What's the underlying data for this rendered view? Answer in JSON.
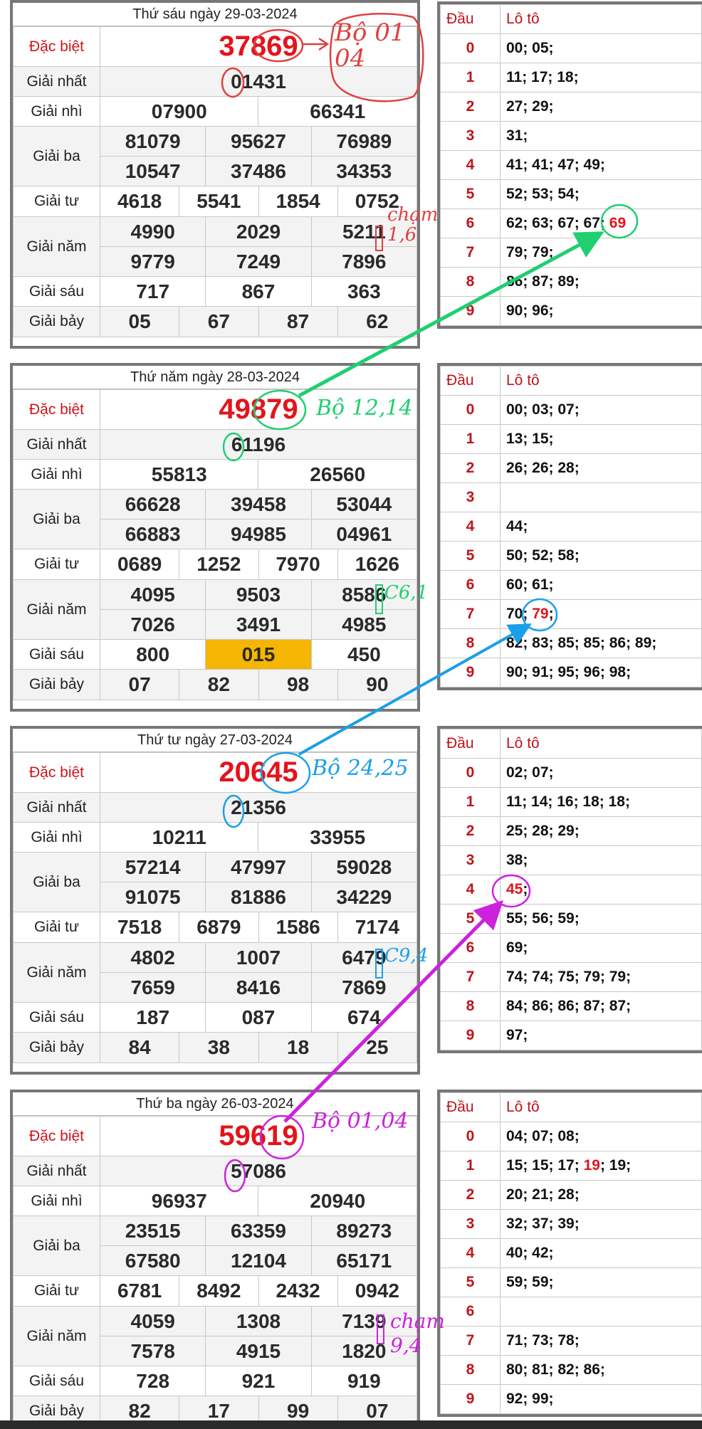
{
  "labels": {
    "special": "Đặc biệt",
    "first": "Giải nhất",
    "second": "Giải nhì",
    "third": "Giải ba",
    "fourth": "Giải tư",
    "fifth": "Giải năm",
    "sixth": "Giải sáu",
    "seventh": "Giải bảy",
    "dau": "Đầu",
    "loto": "Lô tô"
  },
  "days": [
    {
      "date": "Thứ sáu ngày 29-03-2024",
      "special": "37869",
      "first": "01431",
      "second": [
        "07900",
        "66341"
      ],
      "third": [
        "81079",
        "95627",
        "76989",
        "10547",
        "37486",
        "34353"
      ],
      "fourth": [
        "4618",
        "5541",
        "1854",
        "0752"
      ],
      "fifth": [
        "4990",
        "2029",
        "5211",
        "9779",
        "7249",
        "7896"
      ],
      "sixth": [
        "717",
        "867",
        "363"
      ],
      "seventh": [
        "05",
        "67",
        "87",
        "62"
      ],
      "loto": [
        {
          "head": "0",
          "values": "00; 05;"
        },
        {
          "head": "1",
          "values": "11; 17; 18;"
        },
        {
          "head": "2",
          "values": "27; 29;"
        },
        {
          "head": "3",
          "values": "31;"
        },
        {
          "head": "4",
          "values": "41; 41; 47; 49;"
        },
        {
          "head": "5",
          "values": "52; 53; 54;"
        },
        {
          "head": "6",
          "values": "62; 63; 67; 67;",
          "red": "69"
        },
        {
          "head": "7",
          "values": "79; 79;"
        },
        {
          "head": "8",
          "values": "86; 87; 89;"
        },
        {
          "head": "9",
          "values": "90; 96;"
        }
      ]
    },
    {
      "date": "Thứ năm ngày 28-03-2024",
      "special": "49879",
      "first": "61196",
      "second": [
        "55813",
        "26560"
      ],
      "third": [
        "66628",
        "39458",
        "53044",
        "66883",
        "94985",
        "04961"
      ],
      "fourth": [
        "0689",
        "1252",
        "7970",
        "1626"
      ],
      "fifth": [
        "4095",
        "9503",
        "8586",
        "7026",
        "3491",
        "4985"
      ],
      "sixth": [
        "800",
        "015",
        "450"
      ],
      "seventh": [
        "07",
        "82",
        "98",
        "90"
      ],
      "loto": [
        {
          "head": "0",
          "values": "00; 03; 07;"
        },
        {
          "head": "1",
          "values": "13; 15;"
        },
        {
          "head": "2",
          "values": "26; 26; 28;"
        },
        {
          "head": "3",
          "values": ""
        },
        {
          "head": "4",
          "values": "44;"
        },
        {
          "head": "5",
          "values": "50; 52; 58;"
        },
        {
          "head": "6",
          "values": "60; 61;"
        },
        {
          "head": "7",
          "values": "70;",
          "red": "79",
          "after": ";"
        },
        {
          "head": "8",
          "values": "82; 83; 85; 85; 86; 89;"
        },
        {
          "head": "9",
          "values": "90; 91; 95; 96; 98;"
        }
      ]
    },
    {
      "date": "Thứ tư ngày 27-03-2024",
      "special": "20645",
      "first": "21356",
      "second": [
        "10211",
        "33955"
      ],
      "third": [
        "57214",
        "47997",
        "59028",
        "91075",
        "81886",
        "34229"
      ],
      "fourth": [
        "7518",
        "6879",
        "1586",
        "7174"
      ],
      "fifth": [
        "4802",
        "1007",
        "6479",
        "7659",
        "8416",
        "7869"
      ],
      "sixth": [
        "187",
        "087",
        "674"
      ],
      "seventh": [
        "84",
        "38",
        "18",
        "25"
      ],
      "loto": [
        {
          "head": "0",
          "values": "02; 07;"
        },
        {
          "head": "1",
          "values": "11; 14; 16; 18; 18;"
        },
        {
          "head": "2",
          "values": "25; 28; 29;"
        },
        {
          "head": "3",
          "values": "38;"
        },
        {
          "head": "4",
          "values": "",
          "red": "45",
          "after": ";"
        },
        {
          "head": "5",
          "values": "55; 56; 59;"
        },
        {
          "head": "6",
          "values": "69;"
        },
        {
          "head": "7",
          "values": "74; 74; 75; 79; 79;"
        },
        {
          "head": "8",
          "values": "84; 86; 86; 87; 87;"
        },
        {
          "head": "9",
          "values": "97;"
        }
      ]
    },
    {
      "date": "Thứ ba ngày 26-03-2024",
      "special": "59619",
      "first": "57086",
      "second": [
        "96937",
        "20940"
      ],
      "third": [
        "23515",
        "63359",
        "89273",
        "67580",
        "12104",
        "65171"
      ],
      "fourth": [
        "6781",
        "8492",
        "2432",
        "0942"
      ],
      "fifth": [
        "4059",
        "1308",
        "7139",
        "7578",
        "4915",
        "1820"
      ],
      "sixth": [
        "728",
        "921",
        "919"
      ],
      "seventh": [
        "82",
        "17",
        "99",
        "07"
      ],
      "loto": [
        {
          "head": "0",
          "values": "04; 07; 08;"
        },
        {
          "head": "1",
          "values": "15; 15; 17;",
          "red": "19",
          "after": "; 19;"
        },
        {
          "head": "2",
          "values": "20; 21; 28;"
        },
        {
          "head": "3",
          "values": "32; 37; 39;"
        },
        {
          "head": "4",
          "values": "40; 42;"
        },
        {
          "head": "5",
          "values": "59; 59;"
        },
        {
          "head": "6",
          "values": ""
        },
        {
          "head": "7",
          "values": "71; 73; 78;"
        },
        {
          "head": "8",
          "values": "80; 81; 82; 86;"
        },
        {
          "head": "9",
          "values": "92; 99;"
        }
      ]
    }
  ],
  "annotations": {
    "n1": "Bộ 01\n04",
    "n2": "chạm\n1,6",
    "n3": "Bộ 12,14",
    "n4": "C6,1",
    "n5": "Bộ 24,25",
    "n6": "C9,4",
    "n7": "Bộ 01,04",
    "n8": "chạm\n9,4"
  },
  "colors": {
    "special": "#e3141b",
    "highlight": "#f6b500",
    "red_ink": "#e04040",
    "green_ink": "#1fcf70",
    "blue_ink": "#1aa0e8",
    "magenta_ink": "#cc22dd"
  }
}
